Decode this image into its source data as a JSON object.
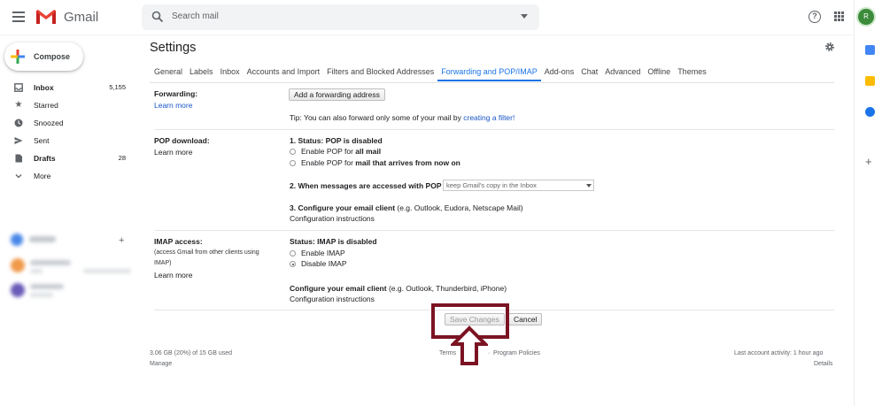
{
  "header": {
    "brand": "Gmail",
    "search_placeholder": "Search mail",
    "avatar_letter": "R",
    "help_symbol": "?"
  },
  "sidebar": {
    "compose_label": "Compose",
    "items": [
      {
        "label": "Inbox",
        "count": "5,155",
        "icon": "inbox-icon"
      },
      {
        "label": "Starred",
        "count": "",
        "icon": "star-icon"
      },
      {
        "label": "Snoozed",
        "count": "",
        "icon": "clock-icon"
      },
      {
        "label": "Sent",
        "count": "",
        "icon": "send-icon"
      },
      {
        "label": "Drafts",
        "count": "28",
        "icon": "draft-icon"
      },
      {
        "label": "More",
        "count": "",
        "icon": "chevron-down-icon"
      }
    ]
  },
  "settings": {
    "title": "Settings",
    "tabs": [
      "General",
      "Labels",
      "Inbox",
      "Accounts and Import",
      "Filters and Blocked Addresses",
      "Forwarding and POP/IMAP",
      "Add-ons",
      "Chat",
      "Advanced",
      "Offline",
      "Themes"
    ],
    "active_tab": "Forwarding and POP/IMAP",
    "forwarding": {
      "title": "Forwarding:",
      "learn_more": "Learn more",
      "add_button": "Add a forwarding address",
      "tip_prefix": "Tip: You can also forward only some of your mail by ",
      "tip_link": "creating a filter!"
    },
    "pop": {
      "title": "POP download:",
      "learn_more": "Learn more",
      "status": "1. Status: POP is disabled",
      "option1_prefix": "Enable POP for ",
      "option1_bold": "all mail",
      "option2_prefix": "Enable POP for ",
      "option2_bold": "mail that arrives from now on",
      "step2_label": "2. When messages are accessed with POP",
      "step2_value": "keep Gmail's copy in the Inbox",
      "step3_label": "3. Configure your email client",
      "step3_hint": " (e.g. Outlook, Eudora, Netscape Mail)",
      "config_link": "Configuration instructions"
    },
    "imap": {
      "title": "IMAP access:",
      "subtitle_line1": "(access Gmail from other clients using",
      "subtitle_line2": "IMAP)",
      "learn_more": "Learn more",
      "status": "Status: IMAP is disabled",
      "enable": "Enable IMAP",
      "disable": "Disable IMAP",
      "selected": "disable",
      "config_label": "Configure your email client",
      "config_hint": " (e.g. Outlook, Thunderbird, iPhone)",
      "config_link": "Configuration instructions"
    },
    "buttons": {
      "save": "Save Changes",
      "cancel": "Cancel"
    }
  },
  "footer": {
    "storage": "3.06 GB (20%) of 15 GB used",
    "manage": "Manage",
    "terms": "Terms",
    "privacy": "Privacy",
    "separator": "·",
    "program_policies": "Program Policies",
    "last_activity": "Last account activity: 1 hour ago",
    "details": "Details"
  },
  "colors": {
    "accent": "#1a73e8",
    "link": "#1a55c7",
    "highlight": "#7b1323"
  }
}
